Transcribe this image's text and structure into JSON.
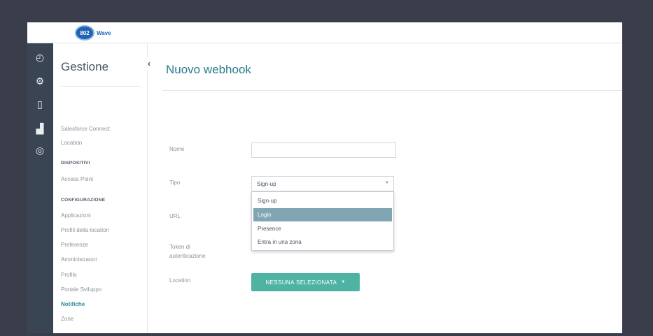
{
  "brand": {
    "logo_number": "802",
    "logo_name": "Wave"
  },
  "rail": {
    "icons": [
      {
        "name": "dashboard-icon",
        "glyph": "◴"
      },
      {
        "name": "network-settings-icon",
        "glyph": "⚙"
      },
      {
        "name": "devices-icon",
        "glyph": "▯"
      },
      {
        "name": "analytics-icon",
        "glyph": "▟"
      },
      {
        "name": "target-icon",
        "glyph": "◎"
      }
    ]
  },
  "sidenav": {
    "title": "Gestione",
    "items": [
      "Salesforce Connect",
      "Location"
    ],
    "section_devices": "DISPOSITIVI",
    "devices_items": [
      "Access Point"
    ],
    "section_config": "CONFIGURAZIONE",
    "config_items": [
      "Applicazioni",
      "Profili della location",
      "Preferenze",
      "Amministratori",
      "Profilo",
      "Portale Sviluppo",
      "Notifiche",
      "Zone"
    ],
    "active_item": "Notifiche",
    "collapse_glyph": "‹"
  },
  "main": {
    "title": "Nuovo webhook",
    "form": {
      "name_label": "Nome",
      "name_value": "",
      "type_label": "Tipo",
      "type_value": "Sign-up",
      "type_options": [
        "Sign-up",
        "Login",
        "Presence",
        "Entra in una zona"
      ],
      "type_highlighted": "Login",
      "url_label": "URL",
      "token_label_line1": "Token di",
      "token_label_line2": "autenticazione",
      "location_label": "Location",
      "location_button": "NESSUNA SELEZIONATA"
    }
  },
  "colors": {
    "rail": "#3a4553",
    "accent": "#2b7c8e",
    "button": "#4fb3a4",
    "highlight": "#7fa6b2"
  }
}
